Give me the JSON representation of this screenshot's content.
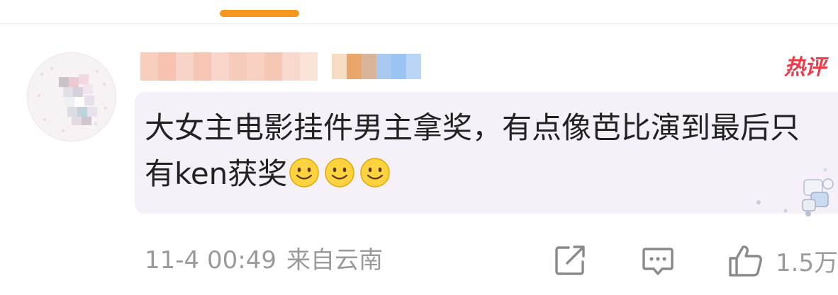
{
  "comment": {
    "hot_label": "热评",
    "text": "大女主电影挂件男主拿奖，有点像芭比演到最后只有ken获奖",
    "emojis": [
      "smile-emoji",
      "smile-emoji",
      "smile-emoji"
    ],
    "timestamp": "11-4 00:49",
    "location": "来自云南",
    "like_count": "1.5万"
  },
  "actions": {
    "share_icon": "share-icon",
    "comment_icon": "comment-icon",
    "like_icon": "thumbs-up-icon"
  },
  "colors": {
    "tab_indicator": "#f5961e",
    "hot_badge": "#ee3b4a",
    "bubble_bg": "#f6f1f8",
    "meta_text": "#9a9a9a",
    "body_text": "#222222"
  }
}
